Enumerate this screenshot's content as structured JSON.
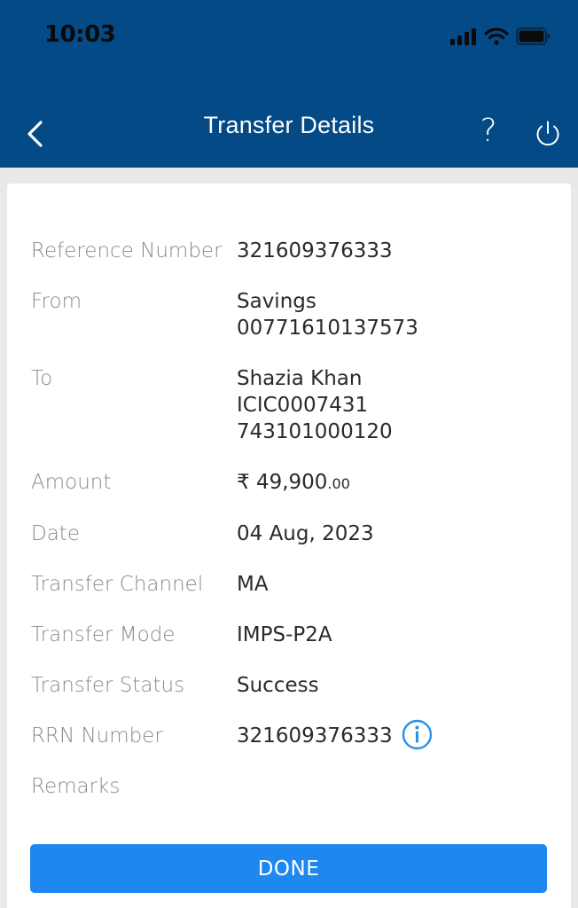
{
  "status_bar": {
    "time": "10:03"
  },
  "header": {
    "title": "Transfer Details",
    "help_label": "?"
  },
  "details": {
    "reference_number": {
      "label": "Reference Number",
      "value": "321609376333"
    },
    "from": {
      "label": "From",
      "line1": "Savings",
      "line2": "00771610137573"
    },
    "to": {
      "label": "To",
      "line1": "Shazia Khan",
      "line2": "ICIC0007431",
      "line3": "743101000120"
    },
    "amount": {
      "label": "Amount",
      "main": "₹ 49,900",
      "decimal": ".00"
    },
    "date": {
      "label": "Date",
      "value": "04 Aug, 2023"
    },
    "transfer_channel": {
      "label": "Transfer Channel",
      "value": "MA"
    },
    "transfer_mode": {
      "label": "Transfer Mode",
      "value": "IMPS-P2A"
    },
    "transfer_status": {
      "label": "Transfer Status",
      "value": "Success"
    },
    "rrn_number": {
      "label": "RRN Number",
      "value": "321609376333"
    },
    "remarks": {
      "label": "Remarks",
      "value": ""
    }
  },
  "actions": {
    "done_label": "DONE"
  },
  "colors": {
    "header_bg": "#034a86",
    "accent": "#1e88f0",
    "info_icon": "#2a8fe8"
  }
}
